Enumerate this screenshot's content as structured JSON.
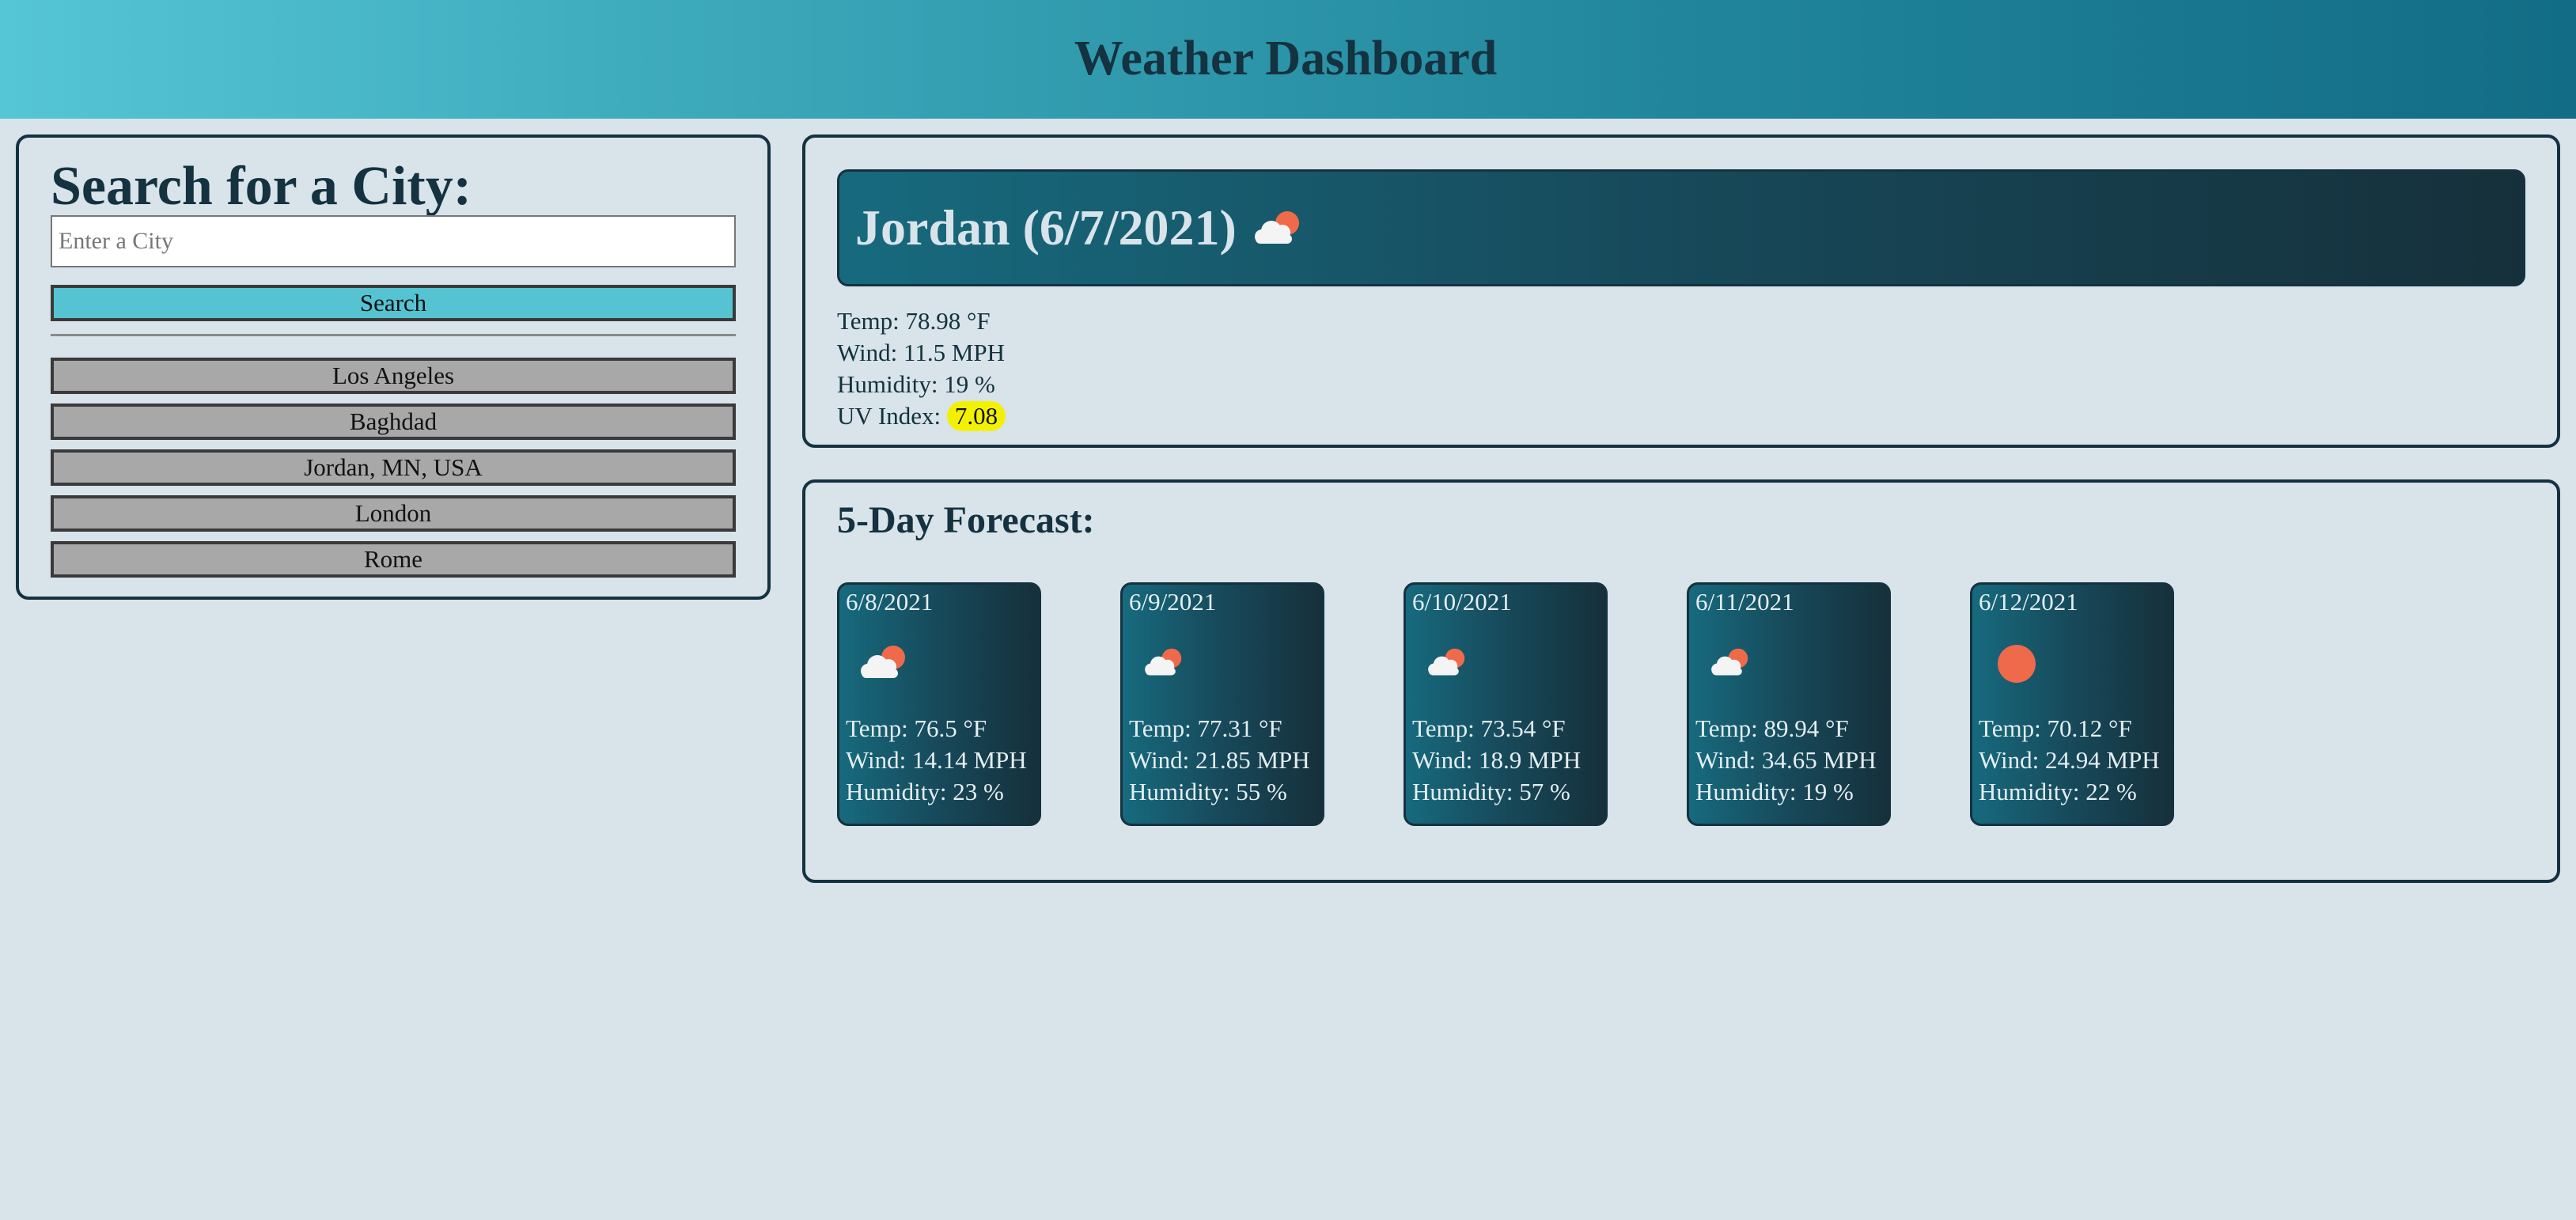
{
  "header": {
    "title": "Weather Dashboard"
  },
  "search": {
    "title": "Search for a City:",
    "placeholder": "Enter a City",
    "value": "",
    "button_label": "Search",
    "history": [
      "Los Angeles",
      "Baghdad",
      "Jordan, MN, USA",
      "London",
      "Rome"
    ]
  },
  "current": {
    "title": "Jordan (6/7/2021)",
    "icon": "cloud-sun-icon",
    "temp": "Temp: 78.98 °F",
    "wind": "Wind: 11.5 MPH",
    "humidity": "Humidity: 19 %",
    "uv_label": "UV Index:",
    "uv_value": "7.08",
    "uv_color": "#f2f200"
  },
  "forecast": {
    "title": "5-Day Forecast:",
    "days": [
      {
        "date": "6/8/2021",
        "icon": "cloud-sun-icon",
        "temp": "Temp: 76.5 °F",
        "wind": "Wind: 14.14 MPH",
        "humidity": "Humidity: 23 %"
      },
      {
        "date": "6/9/2021",
        "icon": "cloud-sun-icon",
        "temp": "Temp: 77.31 °F",
        "wind": "Wind: 21.85 MPH",
        "humidity": "Humidity: 55 %"
      },
      {
        "date": "6/10/2021",
        "icon": "cloud-sun-icon",
        "temp": "Temp: 73.54 °F",
        "wind": "Wind: 18.9 MPH",
        "humidity": "Humidity: 57 %"
      },
      {
        "date": "6/11/2021",
        "icon": "cloud-sun-icon",
        "temp": "Temp: 89.94 °F",
        "wind": "Wind: 34.65 MPH",
        "humidity": "Humidity: 19 %"
      },
      {
        "date": "6/12/2021",
        "icon": "sun-icon",
        "temp": "Temp: 70.12 °F",
        "wind": "Wind: 24.94 MPH",
        "humidity": "Humidity: 22 %"
      }
    ]
  },
  "colors": {
    "header_start": "#55c6d6",
    "header_end": "#126c85",
    "background": "#d8e3ea",
    "search_button": "#55c3d1",
    "history_button": "#a8a8a8",
    "card_start": "#176a7e",
    "card_end": "#16303b",
    "sun": "#ef6a4a"
  }
}
